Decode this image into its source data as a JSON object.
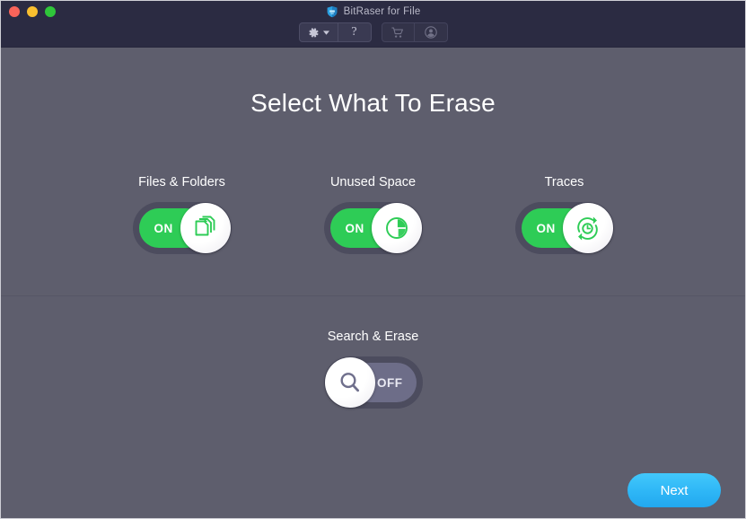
{
  "window": {
    "title": "BitRaser for File",
    "logo_icon": "bitraser-shield-logo",
    "traffic_lights": [
      {
        "name": "close",
        "color": "#f9645a"
      },
      {
        "name": "minimize",
        "color": "#f9bf2f"
      },
      {
        "name": "zoom",
        "color": "#2fc63a"
      }
    ],
    "background_color": "#5e5e6d",
    "titlebar_color": "#2b2b42"
  },
  "toolbar": {
    "settings": {
      "icon": "gear-icon",
      "dropdown_icon": "chevron-down-icon"
    },
    "help": {
      "icon": "question-mark-icon",
      "label": "?"
    },
    "cart": {
      "icon": "shopping-cart-icon"
    },
    "account": {
      "icon": "user-account-icon"
    }
  },
  "main": {
    "heading": "Select What To Erase",
    "toggles_top": [
      {
        "label": "Files & Folders",
        "state": "ON",
        "state_label": "ON",
        "icon": "documents-stack-icon",
        "fill_color": "#2ecc56"
      },
      {
        "label": "Unused Space",
        "state": "ON",
        "state_label": "ON",
        "icon": "pie-chart-icon",
        "fill_color": "#2ecc56"
      },
      {
        "label": "Traces",
        "state": "ON",
        "state_label": "ON",
        "icon": "history-clock-icon",
        "fill_color": "#2ecc56"
      }
    ],
    "toggles_bottom": [
      {
        "label": "Search & Erase",
        "state": "OFF",
        "state_label": "OFF",
        "icon": "magnifier-search-icon",
        "fill_color": "#6d6d88"
      }
    ]
  },
  "footer": {
    "next_label": "Next",
    "next_color": "#2eb6f6"
  }
}
